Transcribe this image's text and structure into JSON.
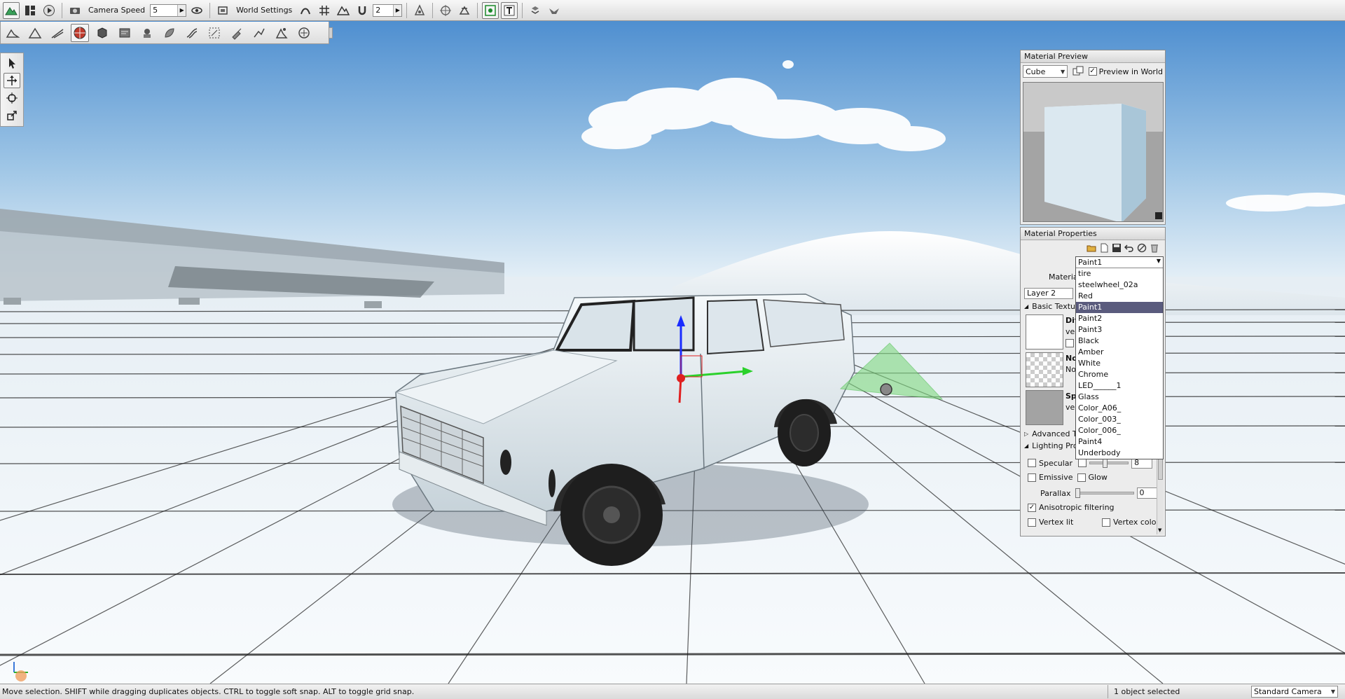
{
  "toolbar": {
    "camera_speed_label": "Camera Speed",
    "camera_speed_value": "5",
    "world_settings_label": "World Settings",
    "grid_value": "2"
  },
  "material_preview": {
    "title": "Material Preview",
    "shape": "Cube",
    "preview_in_world_label": "Preview in World",
    "preview_in_world_checked": true
  },
  "material_properties": {
    "title": "Material Properties",
    "material_label": "Material",
    "selected_material": "Paint1",
    "layer": "Layer 2",
    "sections": {
      "basic_textures": "Basic Textu",
      "advanced": "Advanced T",
      "lighting": "Lighting Prop"
    },
    "textures": {
      "diffuse_title": "Diff",
      "diffuse_sub": "veh",
      "normal_title": "Nor",
      "normal_sub": "Nor",
      "specular_title": "Spe",
      "specular_sub": "veh"
    },
    "props": {
      "specular_label": "Specular",
      "specular_value": "8",
      "emissive_label": "Emissive",
      "glow_label": "Glow",
      "parallax_label": "Parallax",
      "parallax_value": "0",
      "anisotropic_label": "Anisotropic filtering",
      "anisotropic_checked": true,
      "vertex_lit_label": "Vertex lit",
      "vertex_color_label": "Vertex color"
    },
    "dropdown_options": [
      "tire",
      "steelwheel_02a",
      "Red",
      "Paint1",
      "Paint2",
      "Paint3",
      "Black",
      "Amber",
      "White",
      "Chrome",
      "LED______1",
      "Glass",
      "Color_A06_",
      "Color_003_",
      "Color_006_",
      "Paint4",
      "Underbody"
    ],
    "dropdown_selected_index": 3
  },
  "status": {
    "message": "Move selection.  SHIFT while dragging duplicates objects.  CTRL to toggle soft snap.  ALT to toggle grid snap.",
    "selection": "1 object selected",
    "camera": "Standard Camera"
  },
  "colors": {
    "sky_top": "#4f8fd0",
    "sky_horizon": "#e9f2f8",
    "ground": "#f4f8fb",
    "grid_line": "#1a1a1a",
    "selected_item": "#5a5b7d"
  }
}
